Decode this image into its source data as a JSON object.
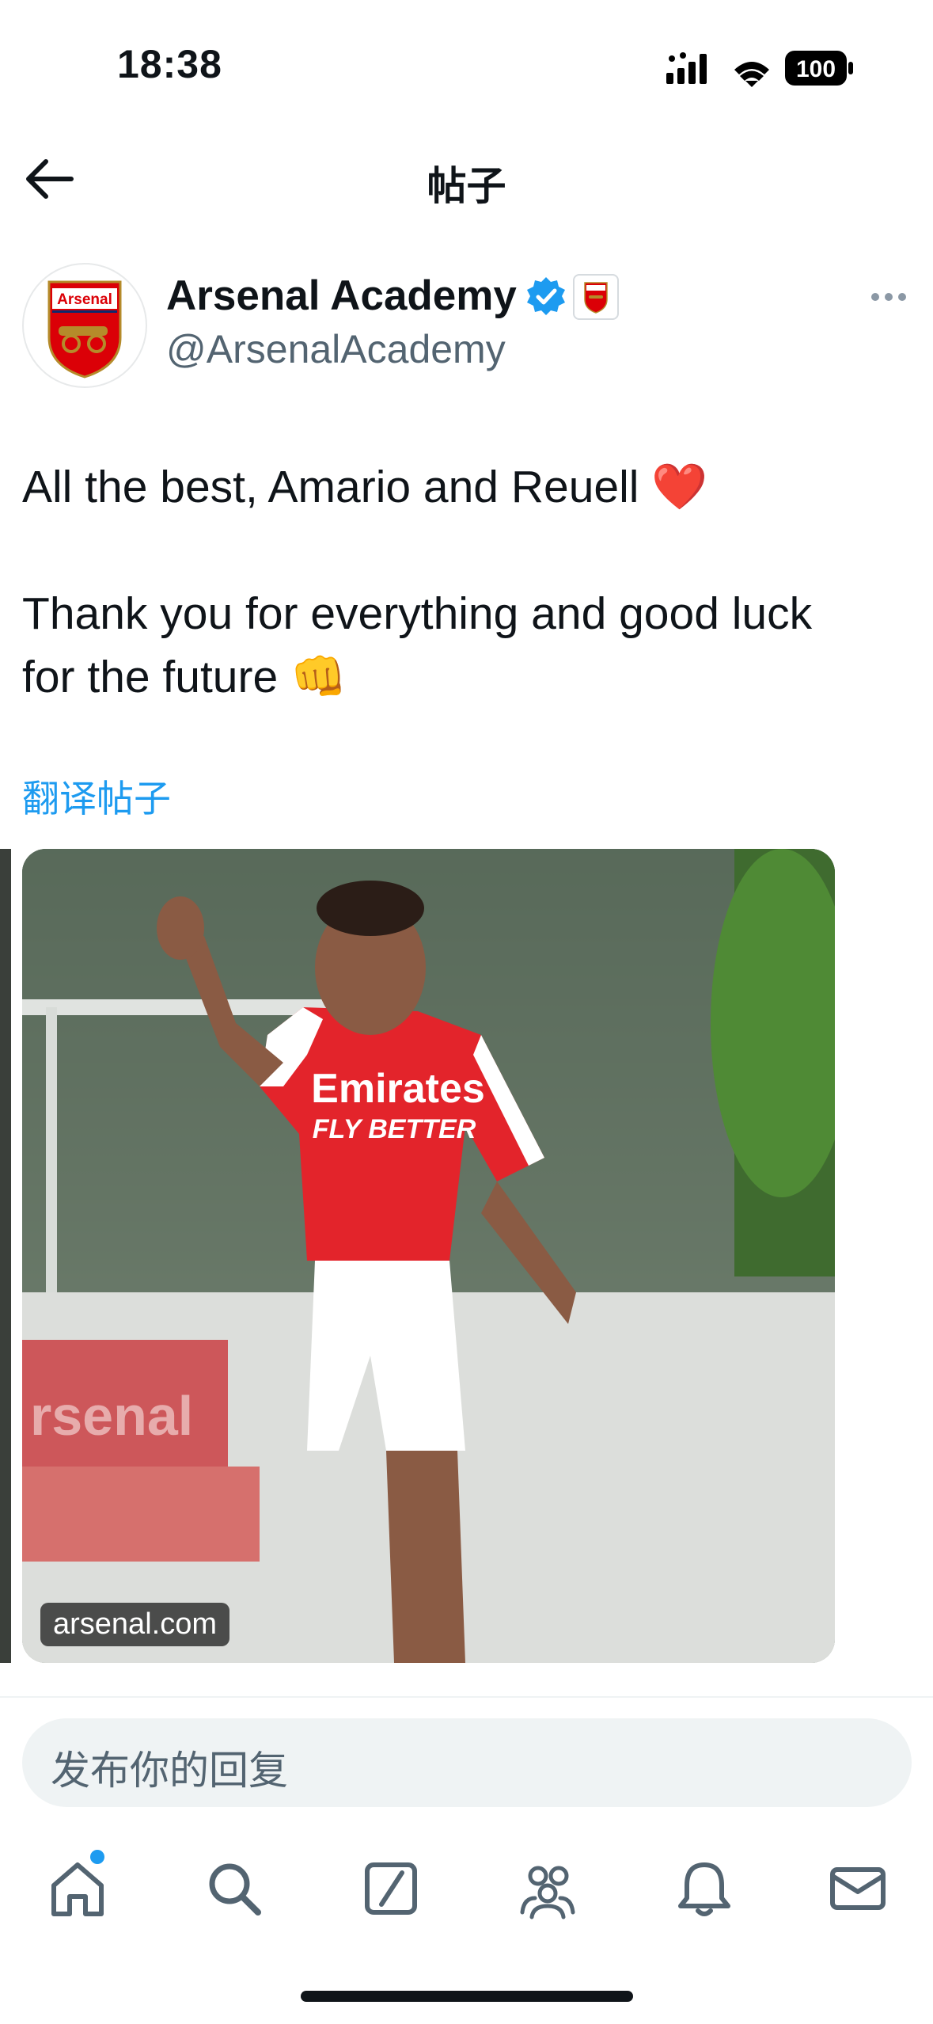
{
  "status_bar": {
    "time": "18:38",
    "battery": "100",
    "icons": [
      "cellular-signal-icon",
      "wifi-icon",
      "battery-icon"
    ]
  },
  "header": {
    "back_icon": "arrow-left-icon",
    "title": "帖子"
  },
  "author": {
    "name": "Arsenal Academy",
    "handle": "@ArsenalAcademy",
    "verified": true,
    "avatar_text": "Arsenal",
    "more_icon": "more-horizontal-icon"
  },
  "tweet": {
    "text": "All the best, Amario and Reuell ❤️\n\nThank you for everything and good luck\nfor the future 👊",
    "translate_label": "翻译帖子"
  },
  "media": {
    "source_label": "arsenal.com",
    "shirt_text_1": "Emirates",
    "shirt_text_2": "FLY BETTER",
    "bg_text": "rsenal"
  },
  "reply": {
    "placeholder": "发布你的回复"
  },
  "tab_bar": {
    "items": [
      "home-icon",
      "search-icon",
      "grok-icon",
      "communities-icon",
      "notifications-icon",
      "messages-icon"
    ]
  },
  "colors": {
    "accent": "#1d9bf0",
    "text": "#0f1419",
    "secondary": "#536471",
    "arsenal_red": "#db0007"
  }
}
